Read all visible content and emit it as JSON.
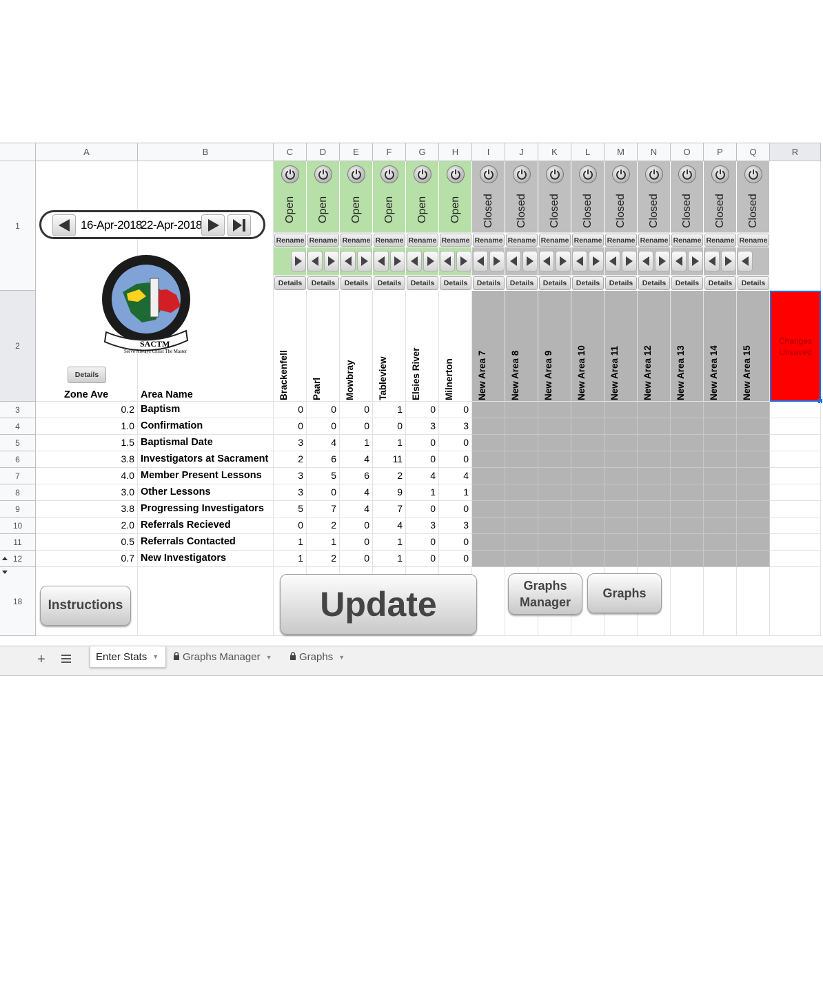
{
  "columns": [
    "A",
    "B",
    "C",
    "D",
    "E",
    "F",
    "G",
    "H",
    "I",
    "J",
    "K",
    "L",
    "M",
    "N",
    "O",
    "P",
    "Q",
    "R"
  ],
  "row_numbers": [
    "1",
    "2",
    "3",
    "4",
    "5",
    "6",
    "7",
    "8",
    "9",
    "10",
    "11",
    "12",
    "18"
  ],
  "date_nav": {
    "start": "16-Apr-2018",
    "end": "22-Apr-2018"
  },
  "logo": {
    "ring_text": "South Africa Cape Town Mission",
    "abbrev": "SACTM",
    "motto": "Serve Always Christ The Master"
  },
  "details_label": "Details",
  "rename_label": "Rename",
  "headers": {
    "zone_ave": "Zone Ave",
    "area_name": "Area Name"
  },
  "areas": [
    {
      "name": "Brackenfell",
      "status": "Open"
    },
    {
      "name": "Paarl",
      "status": "Open"
    },
    {
      "name": "Mowbray",
      "status": "Open"
    },
    {
      "name": "Tableview",
      "status": "Open"
    },
    {
      "name": "Elsies River",
      "status": "Open"
    },
    {
      "name": "Milnerton",
      "status": "Open"
    },
    {
      "name": "New Area 7",
      "status": "Closed"
    },
    {
      "name": "New Area 8",
      "status": "Closed"
    },
    {
      "name": "New Area 9",
      "status": "Closed"
    },
    {
      "name": "New Area 10",
      "status": "Closed"
    },
    {
      "name": "New Area 11",
      "status": "Closed"
    },
    {
      "name": "New Area 12",
      "status": "Closed"
    },
    {
      "name": "New Area 13",
      "status": "Closed"
    },
    {
      "name": "New Area 14",
      "status": "Closed"
    },
    {
      "name": "New Area 15",
      "status": "Closed"
    }
  ],
  "stats": [
    {
      "ave": "0.2",
      "name": "Baptism",
      "values": [
        "0",
        "0",
        "0",
        "1",
        "0",
        "0"
      ]
    },
    {
      "ave": "1.0",
      "name": "Confirmation",
      "values": [
        "0",
        "0",
        "0",
        "0",
        "3",
        "3"
      ]
    },
    {
      "ave": "1.5",
      "name": "Baptismal Date",
      "values": [
        "3",
        "4",
        "1",
        "1",
        "0",
        "0"
      ]
    },
    {
      "ave": "3.8",
      "name": "Investigators at Sacrament",
      "values": [
        "2",
        "6",
        "4",
        "11",
        "0",
        "0"
      ]
    },
    {
      "ave": "4.0",
      "name": "Member Present Lessons",
      "values": [
        "3",
        "5",
        "6",
        "2",
        "4",
        "4"
      ]
    },
    {
      "ave": "3.0",
      "name": "Other Lessons",
      "values": [
        "3",
        "0",
        "4",
        "9",
        "1",
        "1"
      ]
    },
    {
      "ave": "3.8",
      "name": "Progressing Investigators",
      "values": [
        "5",
        "7",
        "4",
        "7",
        "0",
        "0"
      ]
    },
    {
      "ave": "2.0",
      "name": "Referrals Recieved",
      "values": [
        "0",
        "2",
        "0",
        "4",
        "3",
        "3"
      ]
    },
    {
      "ave": "0.5",
      "name": "Referrals Contacted",
      "values": [
        "1",
        "1",
        "0",
        "1",
        "0",
        "0"
      ]
    },
    {
      "ave": "0.7",
      "name": "New Investigators",
      "values": [
        "1",
        "2",
        "0",
        "1",
        "0",
        "0"
      ]
    }
  ],
  "unsaved_indicator": {
    "text": "Changes Unsaved",
    "color": "#ff0000"
  },
  "buttons": {
    "instructions": "Instructions",
    "update": "Update",
    "graphs_manager": "Graphs Manager",
    "graphs": "Graphs"
  },
  "tabs": [
    {
      "label": "Enter Stats",
      "locked": false,
      "active": true
    },
    {
      "label": "Graphs Manager",
      "locked": true,
      "active": false
    },
    {
      "label": "Graphs",
      "locked": true,
      "active": false
    }
  ]
}
